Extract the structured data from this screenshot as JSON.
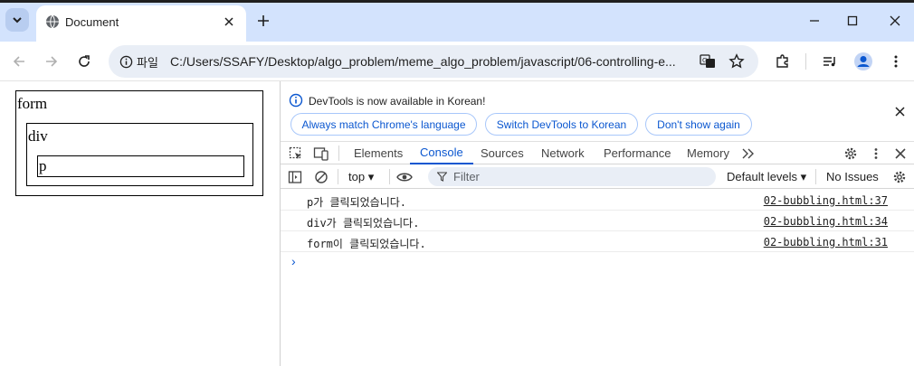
{
  "browser": {
    "tab_title": "Document",
    "omnibox_site_label": "파일",
    "url": "C:/Users/SSAFY/Desktop/algo_problem/meme_algo_problem/javascript/06-controlling-e..."
  },
  "page": {
    "form_label": "form",
    "div_label": "div",
    "p_label": "p"
  },
  "devtools": {
    "infobar": {
      "message": "DevTools is now available in Korean!",
      "btn_match": "Always match Chrome's language",
      "btn_switch": "Switch DevTools to Korean",
      "btn_dont_show": "Don't show again"
    },
    "tabs": [
      "Elements",
      "Console",
      "Sources",
      "Network",
      "Performance",
      "Memory"
    ],
    "active_tab": "Console",
    "console": {
      "context": "top",
      "filter_placeholder": "Filter",
      "levels": "Default levels",
      "issues": "No Issues",
      "logs": [
        {
          "message": "p가 클릭되었습니다.",
          "source": "02-bubbling.html:37"
        },
        {
          "message": "div가 클릭되었습니다.",
          "source": "02-bubbling.html:34"
        },
        {
          "message": "form이 클릭되었습니다.",
          "source": "02-bubbling.html:31"
        }
      ]
    }
  },
  "colors": {
    "tab_strip_bg": "#d3e3fd",
    "accent_blue": "#0b57d0",
    "omnibox_bg": "#e9eef6"
  }
}
